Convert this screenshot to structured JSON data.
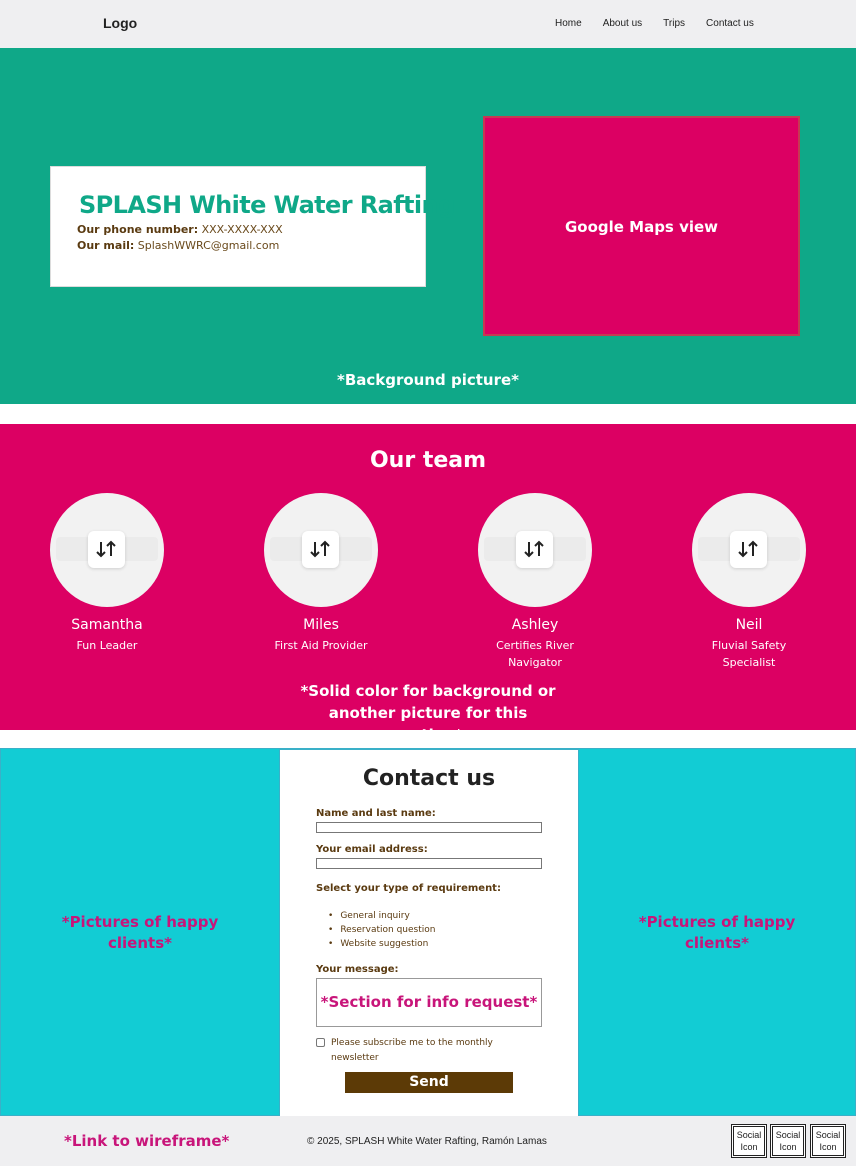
{
  "nav": {
    "logo": "Logo",
    "links": [
      "Home",
      "About us",
      "Trips",
      "Contact us"
    ]
  },
  "hero": {
    "title": "SPLASH White Water Rafting",
    "phone_label": "Our phone number:",
    "phone_value": "XXX-XXXX-XXX",
    "mail_label": "Our mail:",
    "mail_value": "SplashWWRC@gmail.com",
    "map_label": "Google Maps view",
    "note": "*Background picture*"
  },
  "team": {
    "title": "Our team",
    "members": [
      {
        "name": "Samantha",
        "role": "Fun Leader"
      },
      {
        "name": "Miles",
        "role": "First Aid Provider"
      },
      {
        "name": "Ashley",
        "role": "Certifies River Navigator"
      },
      {
        "name": "Neil",
        "role": "Fluvial Safety Specialist"
      }
    ],
    "note": "*Solid color for background or another picture for this section*"
  },
  "contact": {
    "left_note": "*Pictures of happy clients*",
    "right_note": "*Pictures of happy clients*",
    "title": "Contact us",
    "name_label": "Name and last name:",
    "email_label": "Your email address:",
    "requirement_label": "Select your type of requirement:",
    "requirement_options": [
      "General inquiry",
      "Reservation question",
      "Website suggestion"
    ],
    "message_label": "Your message:",
    "message_placeholder": "*Section for info request*",
    "subscribe_label": "Please subscribe me to the monthly newsletter",
    "send_label": "Send"
  },
  "footer": {
    "wireframe_link": "*Link to wireframe*",
    "copyright": "© 2025, SPLASH White Water Rafting, Ramón Lamas",
    "social_label": "Social Icon"
  },
  "colors": {
    "hero_bg": "#0fa888",
    "team_bg": "#dc0063",
    "contact_bg": "#12ccd4",
    "accent_pink": "#c8157a",
    "button_brown": "#5c3a06"
  }
}
